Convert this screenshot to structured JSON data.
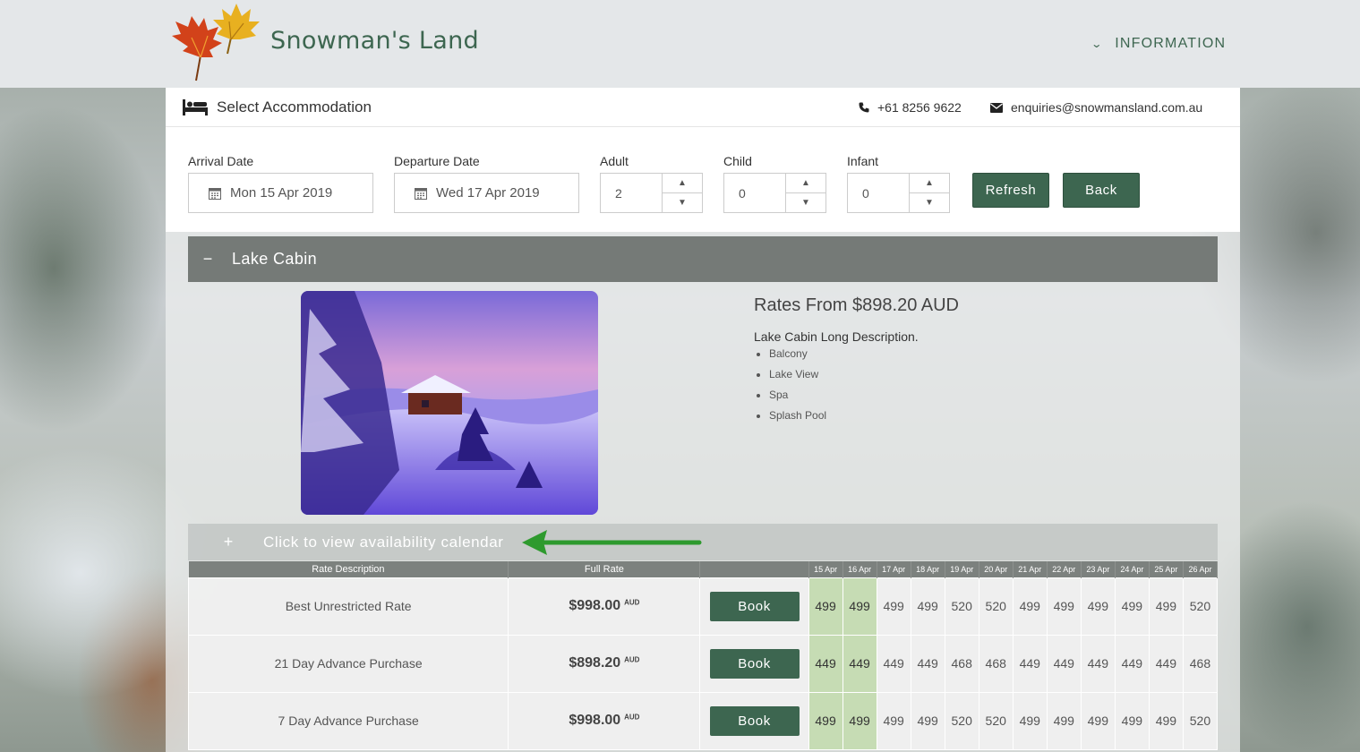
{
  "header": {
    "brand": "Snowman's Land",
    "nav_info": "INFORMATION"
  },
  "panel": {
    "title": "Select Accommodation",
    "phone": "+61 8256 9622",
    "email": "enquiries@snowmansland.com.au"
  },
  "form": {
    "arrival_label": "Arrival Date",
    "arrival_value": "Mon 15 Apr 2019",
    "departure_label": "Departure Date",
    "departure_value": "Wed 17 Apr 2019",
    "adult_label": "Adult",
    "adult_value": "2",
    "child_label": "Child",
    "child_value": "0",
    "infant_label": "Infant",
    "infant_value": "0",
    "refresh_label": "Refresh",
    "back_label": "Back",
    "spin_up": "▲",
    "spin_down": "▼"
  },
  "accommodation": {
    "toggle": "−",
    "title": "Lake Cabin",
    "rates_from": "Rates From $898.20 AUD",
    "long_description": "Lake Cabin Long Description.",
    "features": [
      "Balcony",
      "Lake View",
      "Spa",
      "Splash Pool"
    ],
    "calendar_toggle": "+",
    "calendar_label": "Click to view availability calendar",
    "arrow_color": "#2e9a2e"
  },
  "rates_table": {
    "headers": {
      "description": "Rate Description",
      "full_rate": "Full Rate",
      "dates": [
        "15 Apr",
        "16 Apr",
        "17 Apr",
        "18 Apr",
        "19 Apr",
        "20 Apr",
        "21 Apr",
        "22 Apr",
        "23 Apr",
        "24 Apr",
        "25 Apr",
        "26 Apr"
      ]
    },
    "book_label": "Book",
    "currency": "AUD",
    "rows": [
      {
        "description": "Best Unrestricted Rate",
        "full_rate": "$998.00",
        "prices": [
          "499",
          "499",
          "499",
          "499",
          "520",
          "520",
          "499",
          "499",
          "499",
          "499",
          "499",
          "520"
        ]
      },
      {
        "description": "21 Day Advance Purchase",
        "full_rate": "$898.20",
        "prices": [
          "449",
          "449",
          "449",
          "449",
          "468",
          "468",
          "449",
          "449",
          "449",
          "449",
          "449",
          "468"
        ]
      },
      {
        "description": "7 Day Advance Purchase",
        "full_rate": "$998.00",
        "prices": [
          "499",
          "499",
          "499",
          "499",
          "520",
          "520",
          "499",
          "499",
          "499",
          "499",
          "499",
          "520"
        ]
      }
    ]
  },
  "colors": {
    "brand_green": "#3d6650",
    "selected_date_bg": "#c6dcb4",
    "accordion_bar": "#757a77"
  }
}
